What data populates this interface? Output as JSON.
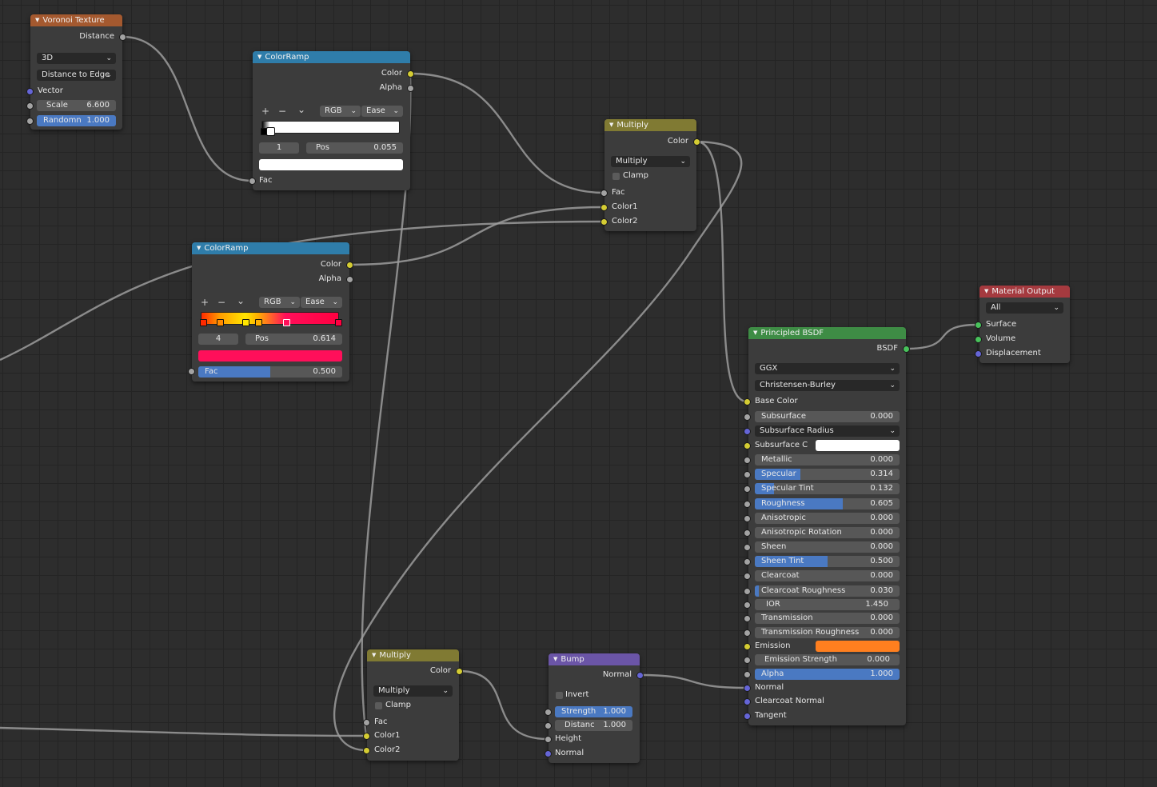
{
  "colors": {
    "grid_bg": "#2d2d2d",
    "node_body": "#3c3c3c",
    "header_voronoi": "#a4592f",
    "header_colorramp": "#2f7daa",
    "header_mix": "#807a33",
    "header_shader": "#3e8c45",
    "header_output": "#a53a3f",
    "header_vector": "#6b55a7",
    "socket_color": "#d4cc33",
    "socket_float": "#a3a3a3",
    "socket_vector": "#6565d6",
    "socket_shader": "#48c25b",
    "slider_fill": "#4a79c2",
    "emission_color": "#ff7f1f",
    "ramp2_active_color": "#ff0f5a"
  },
  "voronoi": {
    "title": "Voronoi Texture",
    "out_distance": "Distance",
    "dimensions": "3D",
    "feature": "Distance to Edge",
    "in_vector": "Vector",
    "scale_label": "Scale",
    "scale_value": "6.600",
    "randomness_label": "Randomn",
    "randomness_value": "1.000",
    "randomness": 1.0
  },
  "ramp1": {
    "title": "ColorRamp",
    "out_color": "Color",
    "out_alpha": "Alpha",
    "add": "+",
    "remove": "−",
    "menu": "⌄",
    "color_mode": "RGB",
    "interpolation": "Ease",
    "active_index": "1",
    "pos_label": "Pos",
    "pos_value": "0.055",
    "stops": [
      0.0,
      0.055
    ],
    "in_fac": "Fac"
  },
  "ramp2": {
    "title": "ColorRamp",
    "out_color": "Color",
    "out_alpha": "Alpha",
    "add": "+",
    "remove": "−",
    "menu": "⌄",
    "color_mode": "RGB",
    "interpolation": "Ease",
    "active_index": "4",
    "pos_label": "Pos",
    "pos_value": "0.614",
    "stops": [
      0.0,
      0.13,
      0.32,
      0.41,
      0.614,
      1.0
    ],
    "fac_label": "Fac",
    "fac_value": "0.500",
    "fac": 0.5
  },
  "multiply_top": {
    "title": "Multiply",
    "out_color": "Color",
    "blend_type": "Multiply",
    "clamp": "Clamp",
    "in_fac": "Fac",
    "in_color1": "Color1",
    "in_color2": "Color2"
  },
  "multiply_bottom": {
    "title": "Multiply",
    "out_color": "Color",
    "blend_type": "Multiply",
    "clamp": "Clamp",
    "in_fac": "Fac",
    "in_color1": "Color1",
    "in_color2": "Color2"
  },
  "bump": {
    "title": "Bump",
    "out_normal": "Normal",
    "invert": "Invert",
    "strength_label": "Strength",
    "strength_value": "1.000",
    "strength": 1.0,
    "distance_label": "Distanc",
    "distance_value": "1.000",
    "in_height": "Height",
    "in_normal": "Normal"
  },
  "material_output": {
    "title": "Material Output",
    "target": "All",
    "in_surface": "Surface",
    "in_volume": "Volume",
    "in_displacement": "Displacement"
  },
  "bsdf": {
    "title": "Principled BSDF",
    "out_bsdf": "BSDF",
    "distribution": "GGX",
    "subsurface_method": "Christensen-Burley",
    "base_color": "Base Color",
    "subsurface_radius": "Subsurface Radius",
    "subsurface_color": "Subsurface C",
    "emission": "Emission",
    "normal": "Normal",
    "clearcoat_normal": "Clearcoat Normal",
    "tangent": "Tangent",
    "sliders": [
      {
        "label": "Subsurface",
        "value": "0.000",
        "fill": 0.0
      },
      {
        "label": "Metallic",
        "value": "0.000",
        "fill": 0.0
      },
      {
        "label": "Specular",
        "value": "0.314",
        "fill": 0.314
      },
      {
        "label": "Specular Tint",
        "value": "0.132",
        "fill": 0.132
      },
      {
        "label": "Roughness",
        "value": "0.605",
        "fill": 0.605
      },
      {
        "label": "Anisotropic",
        "value": "0.000",
        "fill": 0.0
      },
      {
        "label": "Anisotropic Rotation",
        "value": "0.000",
        "fill": 0.0
      },
      {
        "label": "Sheen",
        "value": "0.000",
        "fill": 0.0
      },
      {
        "label": "Sheen Tint",
        "value": "0.500",
        "fill": 0.5
      },
      {
        "label": "Clearcoat",
        "value": "0.000",
        "fill": 0.0
      },
      {
        "label": "Clearcoat Roughness",
        "value": "0.030",
        "fill": 0.03
      },
      {
        "label": "IOR",
        "value": "1.450"
      },
      {
        "label": "Transmission",
        "value": "0.000",
        "fill": 0.0
      },
      {
        "label": "Transmission Roughness",
        "value": "0.000",
        "fill": 0.0
      },
      {
        "label": "Emission Strength",
        "value": "0.000"
      },
      {
        "label": "Alpha",
        "value": "1.000",
        "fill": 1.0
      }
    ]
  }
}
